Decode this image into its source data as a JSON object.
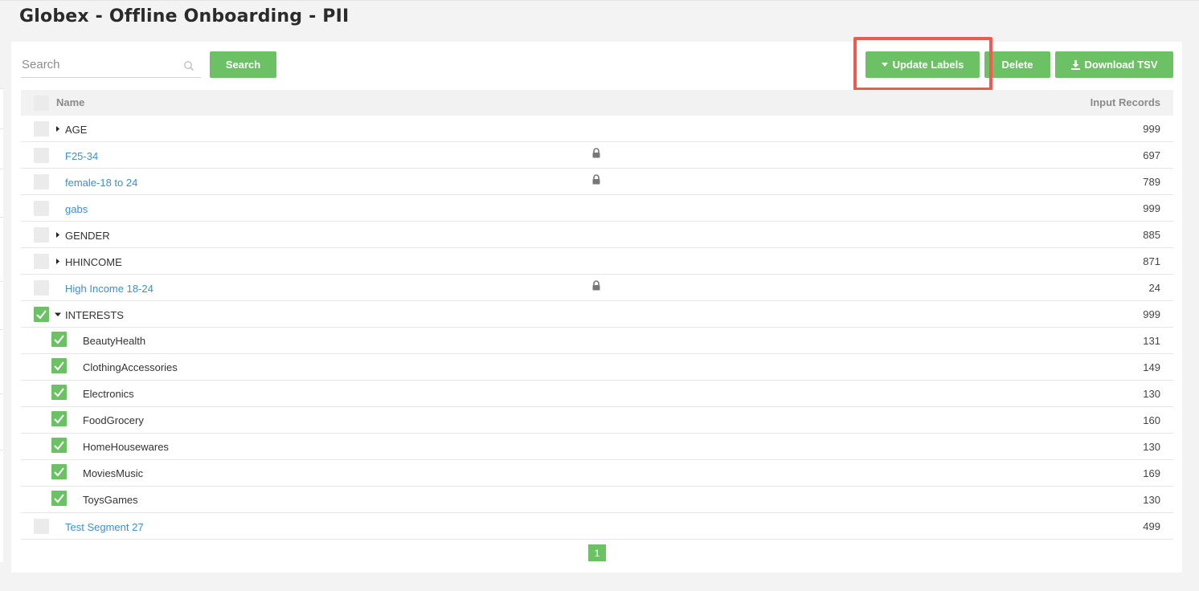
{
  "page": {
    "title": "Globex - Offline Onboarding - PII"
  },
  "toolbar": {
    "search_placeholder": "Search",
    "search_label": "Search",
    "update_label": "Update Labels",
    "delete_label": "Delete",
    "download_label": "Download TSV"
  },
  "table": {
    "headers": {
      "name": "Name",
      "records": "Input Records"
    },
    "rows": [
      {
        "name": "AGE",
        "count": "999",
        "kind": "group",
        "expanded": false,
        "checked": false,
        "locked": false
      },
      {
        "name": "F25-34",
        "count": "697",
        "kind": "link",
        "checked": false,
        "locked": true
      },
      {
        "name": "female-18 to 24",
        "count": "789",
        "kind": "link",
        "checked": false,
        "locked": true
      },
      {
        "name": "gabs",
        "count": "999",
        "kind": "link",
        "checked": false,
        "locked": false
      },
      {
        "name": "GENDER",
        "count": "885",
        "kind": "group",
        "expanded": false,
        "checked": false,
        "locked": false
      },
      {
        "name": "HHINCOME",
        "count": "871",
        "kind": "group",
        "expanded": false,
        "checked": false,
        "locked": false
      },
      {
        "name": "High Income 18-24",
        "count": "24",
        "kind": "link",
        "checked": false,
        "locked": true
      },
      {
        "name": "INTERESTS",
        "count": "999",
        "kind": "group",
        "expanded": true,
        "checked": true,
        "locked": false
      },
      {
        "name": "BeautyHealth",
        "count": "131",
        "kind": "child",
        "checked": true,
        "locked": false
      },
      {
        "name": "ClothingAccessories",
        "count": "149",
        "kind": "child",
        "checked": true,
        "locked": false
      },
      {
        "name": "Electronics",
        "count": "130",
        "kind": "child",
        "checked": true,
        "locked": false
      },
      {
        "name": "FoodGrocery",
        "count": "160",
        "kind": "child",
        "checked": true,
        "locked": false
      },
      {
        "name": "HomeHousewares",
        "count": "130",
        "kind": "child",
        "checked": true,
        "locked": false
      },
      {
        "name": "MoviesMusic",
        "count": "169",
        "kind": "child",
        "checked": true,
        "locked": false
      },
      {
        "name": "ToysGames",
        "count": "130",
        "kind": "child",
        "checked": true,
        "locked": false
      },
      {
        "name": "Test Segment 27",
        "count": "499",
        "kind": "link",
        "checked": false,
        "locked": false
      }
    ]
  },
  "pagination": {
    "current": "1"
  },
  "colors": {
    "accent": "#6cc165",
    "link": "#3d8fd1",
    "highlight": "#ec5b4d"
  },
  "icons": {
    "search": "search-icon",
    "lock": "lock-icon",
    "caret_down": "caret-down-icon",
    "caret_right": "caret-right-icon",
    "download": "download-icon",
    "check": "check-icon"
  }
}
